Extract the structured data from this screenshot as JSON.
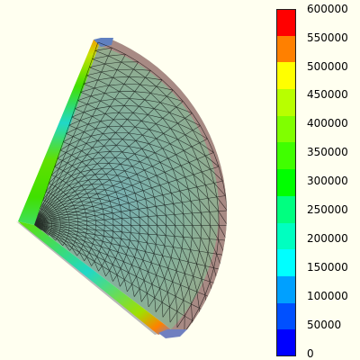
{
  "colorbar": {
    "ticks": [
      "600000",
      "550000",
      "500000",
      "450000",
      "400000",
      "350000",
      "300000",
      "250000",
      "200000",
      "150000",
      "100000",
      "50000",
      "0"
    ],
    "colors": [
      "#ff0000",
      "#ff8000",
      "#ffff00",
      "#b8ff00",
      "#80ff00",
      "#40ff00",
      "#00ff00",
      "#00ff80",
      "#00ffc0",
      "#00ffff",
      "#00a0ff",
      "#0050ff",
      "#0000ff"
    ]
  },
  "mesh": {
    "face_color": "#8cae98",
    "wall_color": "#aa8080",
    "edge_color": "#000000",
    "shadow_color": "#b0b0b0"
  }
}
